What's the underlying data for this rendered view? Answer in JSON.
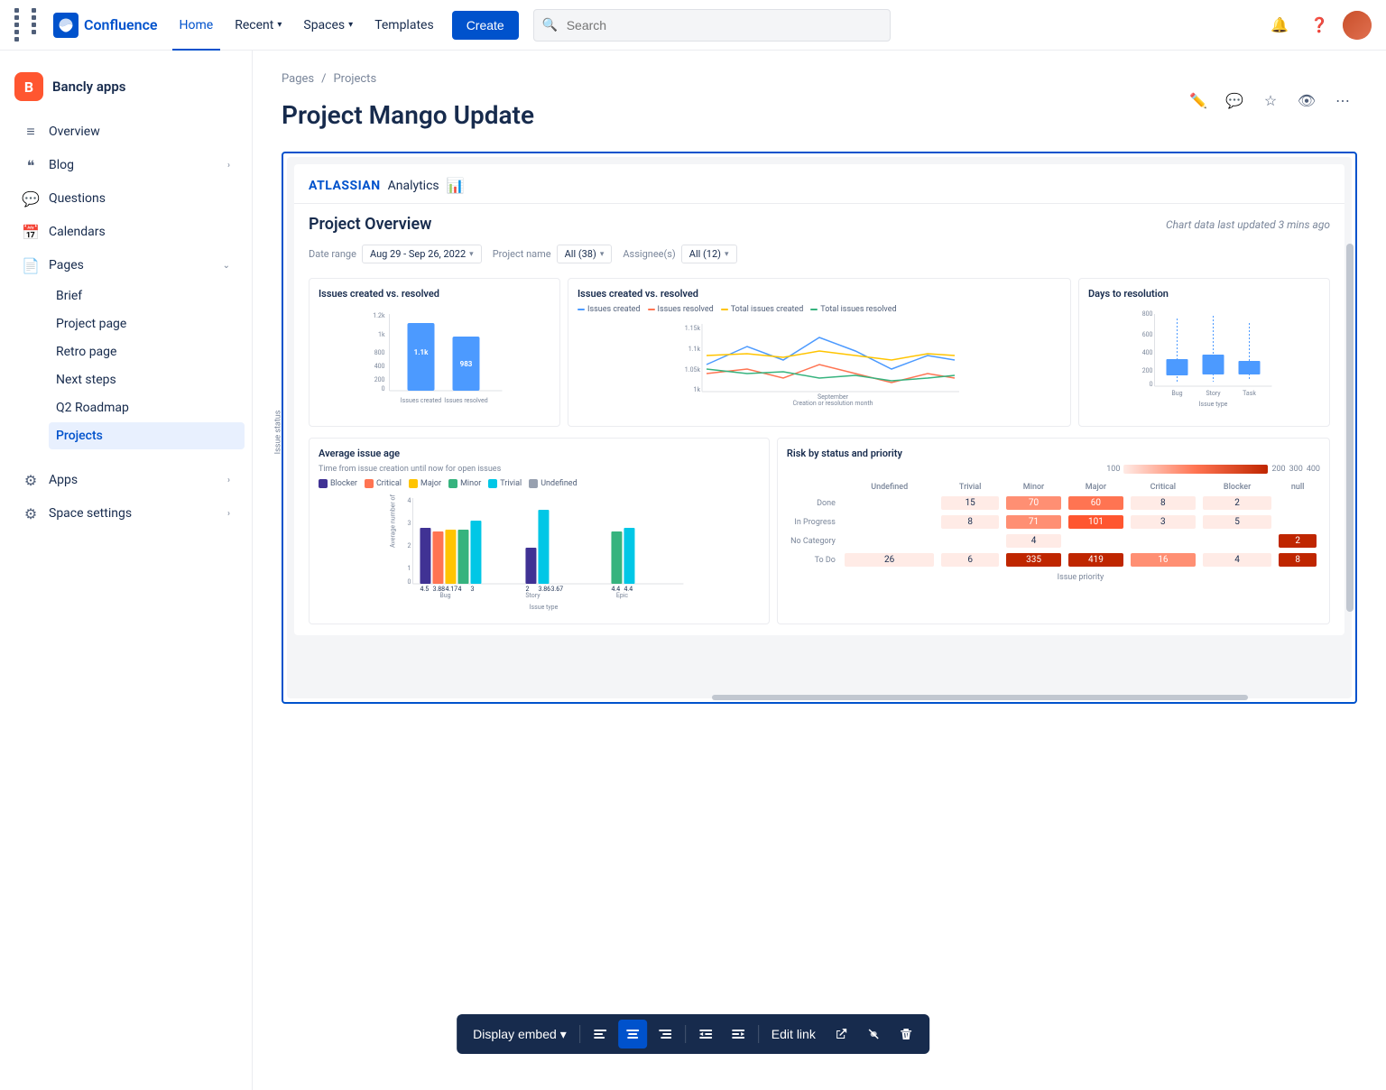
{
  "topNav": {
    "logoText": "Confluence",
    "links": [
      {
        "id": "home",
        "label": "Home",
        "active": true
      },
      {
        "id": "recent",
        "label": "Recent",
        "hasArrow": true
      },
      {
        "id": "spaces",
        "label": "Spaces",
        "hasArrow": true
      },
      {
        "id": "templates",
        "label": "Templates",
        "hasArrow": false
      }
    ],
    "createLabel": "Create",
    "search": {
      "placeholder": "Search"
    }
  },
  "sidebar": {
    "brandName": "Bancly apps",
    "items": [
      {
        "id": "overview",
        "label": "Overview",
        "icon": "≡"
      },
      {
        "id": "blog",
        "label": "Blog",
        "icon": "❝",
        "hasArrow": true
      },
      {
        "id": "questions",
        "label": "Questions",
        "icon": "💬"
      },
      {
        "id": "calendars",
        "label": "Calendars",
        "icon": "📅"
      },
      {
        "id": "pages",
        "label": "Pages",
        "icon": "📄",
        "hasArrow": true,
        "expanded": true
      }
    ],
    "subPages": [
      {
        "id": "brief",
        "label": "Brief"
      },
      {
        "id": "project-page",
        "label": "Project page"
      },
      {
        "id": "retro-page",
        "label": "Retro page"
      },
      {
        "id": "next-steps",
        "label": "Next steps"
      },
      {
        "id": "q2-roadmap",
        "label": "Q2 Roadmap"
      },
      {
        "id": "projects",
        "label": "Projects",
        "active": true
      }
    ],
    "bottomItems": [
      {
        "id": "apps",
        "label": "Apps",
        "icon": "⚙",
        "hasArrow": true
      },
      {
        "id": "space-settings",
        "label": "Space settings",
        "icon": "⚙",
        "hasArrow": true
      }
    ]
  },
  "breadcrumb": {
    "items": [
      "Pages",
      "Projects"
    ]
  },
  "page": {
    "title": "Project Mango Update"
  },
  "pageActions": {
    "edit": "✏️",
    "comment": "💬",
    "star": "☆",
    "watch": "👁",
    "more": "⋯"
  },
  "analytics": {
    "brand": "ATLASSIAN",
    "brandLabel": "Analytics",
    "panelTitle": "Project Overview",
    "lastUpdated": "Chart data last updated 3 mins ago",
    "filters": {
      "dateRangeLabel": "Date range",
      "dateRangeValue": "Aug 29 - Sep 26, 2022",
      "projectLabel": "Project name",
      "projectValue": "All (38)",
      "assigneeLabel": "Assignee(s)",
      "assigneeValue": "All (12)"
    },
    "chart1": {
      "title": "Issues created vs. resolved",
      "bars": [
        {
          "height": 80,
          "label": "Issues created",
          "value": "1.1k"
        },
        {
          "height": 65,
          "label": "Issues resolved",
          "value": "983"
        }
      ]
    },
    "chart2": {
      "title": "Issues created vs. resolved",
      "legend": [
        "Issues created",
        "Issues resolved",
        "Total issues created",
        "Total issues resolved"
      ]
    },
    "chart3": {
      "title": "Days to resolution",
      "categories": [
        "Bug",
        "Story",
        "Task"
      ]
    },
    "chart4": {
      "title": "Average issue age",
      "subtitle": "Time from issue creation until now for open issues",
      "legend": [
        "Blocker",
        "Critical",
        "Major",
        "Minor",
        "Trivial",
        "Undefined"
      ]
    },
    "chart5": {
      "title": "Risk by status and priority",
      "rowLabels": [
        "Done",
        "In Progress",
        "No Category",
        "To Do"
      ],
      "colLabels": [
        "Undefined",
        "Trivial",
        "Minor",
        "Major",
        "Critical",
        "Blocker",
        "null"
      ],
      "cells": {
        "done": [
          null,
          15,
          70,
          60,
          8,
          2,
          null
        ],
        "inProgress": [
          null,
          8,
          71,
          101,
          3,
          5,
          null
        ],
        "noCategory": [
          null,
          null,
          4,
          null,
          null,
          null,
          2
        ],
        "toDo": [
          26,
          6,
          335,
          419,
          16,
          4,
          8
        ]
      }
    }
  },
  "toolbar": {
    "displayEmbed": "Display embed",
    "embedArrow": "▾",
    "editLink": "Edit link",
    "icons": {
      "alignLeft": "◧",
      "alignCenter": "⧈",
      "alignRight": "◨",
      "indentLeft": "⇤",
      "indentRight": "⇥",
      "openExternal": "⬡",
      "unlink": "⛓",
      "delete": "🗑"
    }
  }
}
